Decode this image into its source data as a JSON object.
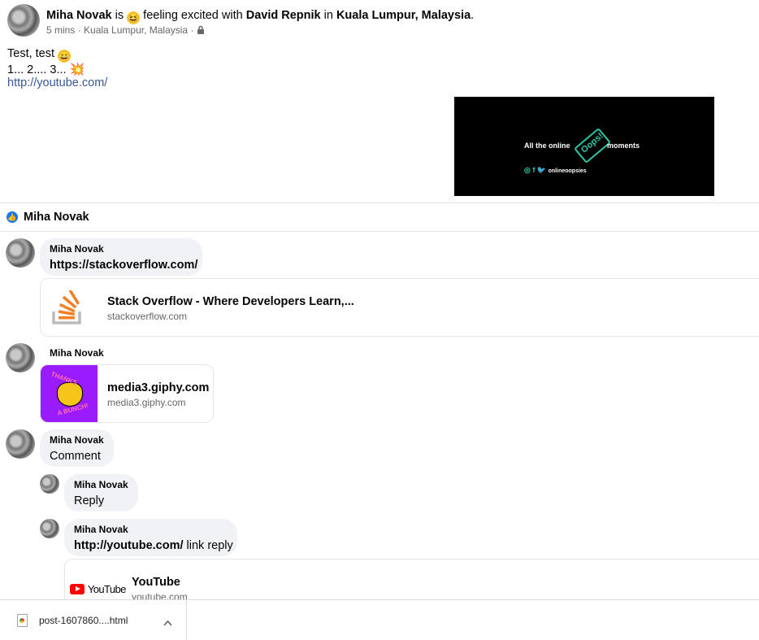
{
  "post": {
    "author": "Miha Novak",
    "is_word": "is",
    "feeling": "feeling excited with",
    "with_person": "David Repnik",
    "in_word": "in",
    "location": "Kuala Lumpur, Malaysia",
    "period": ".",
    "time": "5 mins",
    "sep": "·",
    "place": "Kuala Lumpur, Malaysia",
    "line1": "Test, test",
    "line2": "1... 2.... 3...",
    "link": "http://youtube.com/"
  },
  "video_thumb": {
    "text_left": "All the online",
    "logo_text": "Oops!",
    "text_right": "moments",
    "handle": "onlineoopsies"
  },
  "reaction": {
    "name": "Miha Novak"
  },
  "comments": [
    {
      "name": "Miha Novak",
      "text": "https://stackoverflow.com/",
      "card": {
        "title": "Stack Overflow - Where Developers Learn,...",
        "domain": "stackoverflow.com"
      }
    },
    {
      "name": "Miha Novak",
      "card": {
        "title": "media3.giphy.com",
        "domain": "media3.giphy.com",
        "gif_line1": "THANKS",
        "gif_line2": "A BUNCH!"
      }
    },
    {
      "name": "Miha Novak",
      "text": "Comment"
    }
  ],
  "replies": [
    {
      "name": "Miha Novak",
      "text": "Reply"
    },
    {
      "name": "Miha Novak",
      "link": "http://youtube.com/",
      "text": "link reply",
      "card": {
        "title": "YouTube",
        "domain": "youtube.com",
        "logo": "YouTube"
      }
    }
  ],
  "download_bar": {
    "filename": "post-1607860....html"
  },
  "colors": {
    "link": "#385898",
    "like_blue": "#1877f2",
    "bubble": "#f0f2f5",
    "so_orange": "#f48024",
    "giphy_purple": "#9b1bff"
  }
}
